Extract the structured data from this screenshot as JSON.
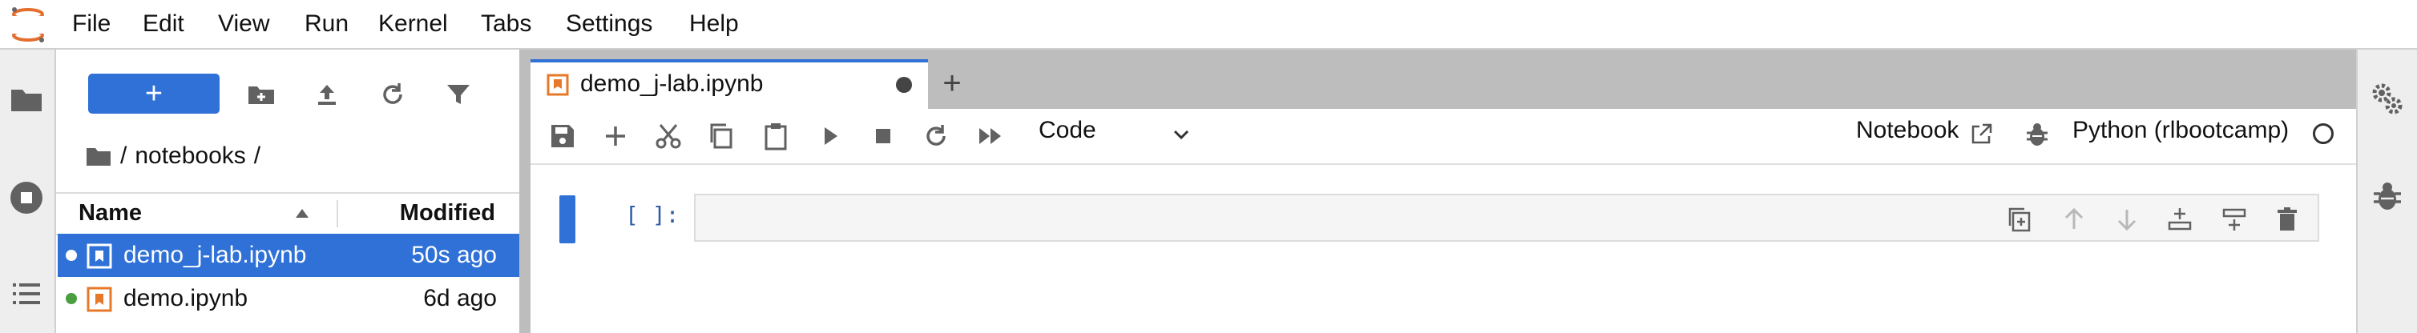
{
  "menu": [
    "File",
    "Edit",
    "View",
    "Run",
    "Kernel",
    "Tabs",
    "Settings",
    "Help"
  ],
  "filebrowser": {
    "new_label": "+",
    "breadcrumb_root": "/",
    "breadcrumb_folder": "notebooks",
    "breadcrumb_end": "/",
    "columns": {
      "name": "Name",
      "modified": "Modified"
    },
    "files": [
      {
        "name": "demo_j-lab.ipynb",
        "modified": "50s ago",
        "selected": true
      },
      {
        "name": "demo.ipynb",
        "modified": "6d ago",
        "selected": false
      }
    ]
  },
  "tabs": [
    {
      "label": "demo_j-lab.ipynb",
      "dirty": true
    }
  ],
  "new_tab_label": "+",
  "notebook": {
    "cell_type": "Code",
    "notebook_label": "Notebook",
    "kernel": "Python (rlbootcamp)",
    "cell_prompt": "[ ]:"
  },
  "colors": {
    "accent": "#2f71d6",
    "notebook_icon": "#e7782a",
    "running_dot": "#4a9e3f"
  }
}
